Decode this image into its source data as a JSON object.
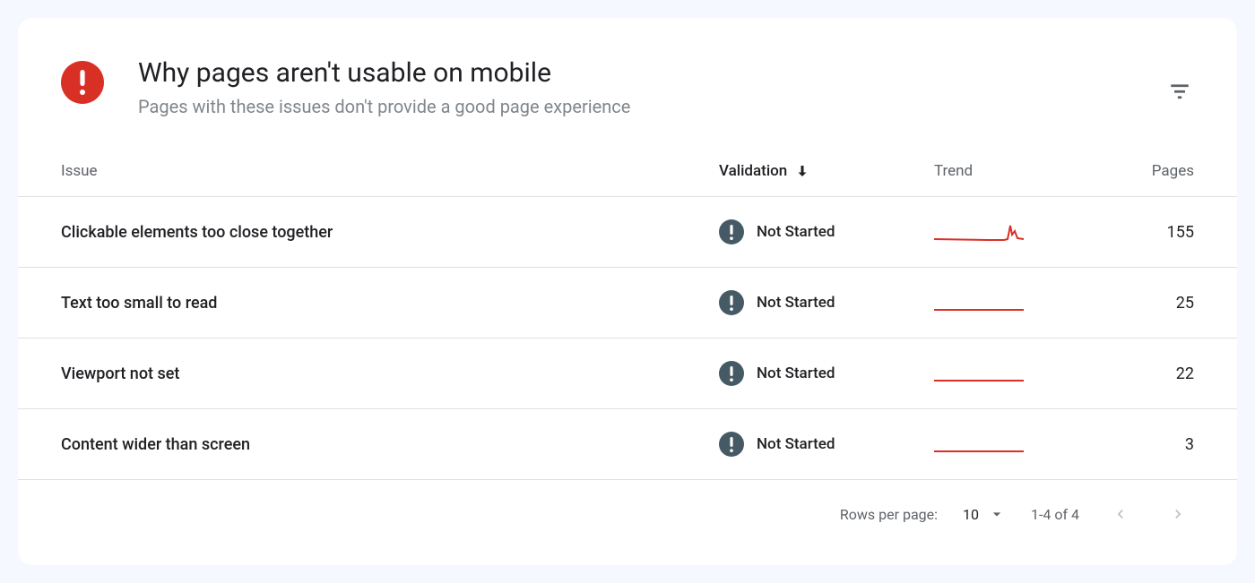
{
  "header": {
    "title": "Why pages aren't usable on mobile",
    "subtitle": "Pages with these issues don't provide a good page experience"
  },
  "columns": {
    "issue": "Issue",
    "validation": "Validation",
    "trend": "Trend",
    "pages": "Pages"
  },
  "rows": [
    {
      "issue": "Clickable elements too close together",
      "validation": "Not Started",
      "pages": "155",
      "trend": "spike"
    },
    {
      "issue": "Text too small to read",
      "validation": "Not Started",
      "pages": "25",
      "trend": "flat"
    },
    {
      "issue": "Viewport not set",
      "validation": "Not Started",
      "pages": "22",
      "trend": "flat"
    },
    {
      "issue": "Content wider than screen",
      "validation": "Not Started",
      "pages": "3",
      "trend": "flat"
    }
  ],
  "pagination": {
    "rows_label": "Rows per page:",
    "rows_value": "10",
    "range": "1-4 of 4"
  }
}
